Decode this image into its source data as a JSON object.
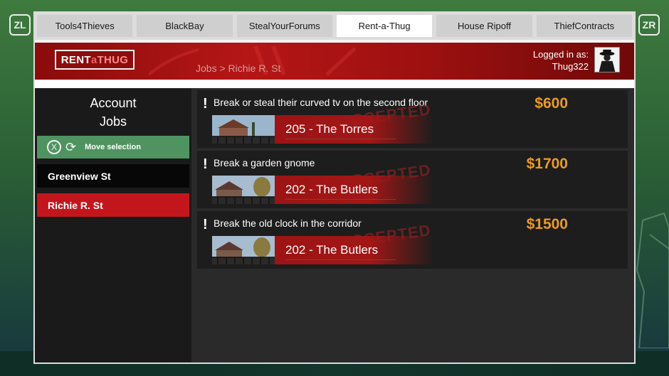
{
  "controller": {
    "left_shoulder": "ZL",
    "right_shoulder": "ZR"
  },
  "tabs": [
    {
      "label": "Tools4Thieves",
      "active": false
    },
    {
      "label": "BlackBay",
      "active": false
    },
    {
      "label": "StealYourForums",
      "active": false
    },
    {
      "label": "Rent-a-Thug",
      "active": true
    },
    {
      "label": "House Ripoff",
      "active": false
    },
    {
      "label": "ThiefContracts",
      "active": false
    }
  ],
  "header": {
    "logo": {
      "part1": "RENT",
      "part2": "a",
      "part3": "THUG"
    },
    "breadcrumb": "Jobs > Richie R. St",
    "login_label": "Logged in as:",
    "username": "Thug322"
  },
  "sidebar": {
    "title_line1": "Account",
    "title_line2": "Jobs",
    "move_selection": {
      "x_button": "X",
      "label": "Move selection"
    },
    "streets": [
      {
        "label": "Greenview St",
        "active": false
      },
      {
        "label": "Richie R. St",
        "active": true
      }
    ]
  },
  "jobs": [
    {
      "marker": "!",
      "description": "Break or steal their curved tv on the second floor",
      "reward": "$600",
      "unit": "205 - The Torres",
      "stamp": "ACCEPTED"
    },
    {
      "marker": "!",
      "description": "Break a garden gnome",
      "reward": "$1700",
      "unit": "202 - The Butlers",
      "stamp": "ACCEPTED"
    },
    {
      "marker": "!",
      "description": "Break the old clock in the corridor",
      "reward": "$1500",
      "unit": "202 - The Butlers",
      "stamp": "ACCEPTED"
    }
  ],
  "colors": {
    "accent_red": "#c3161c",
    "reward_orange": "#e89a2e",
    "move_green": "#4f9460"
  }
}
